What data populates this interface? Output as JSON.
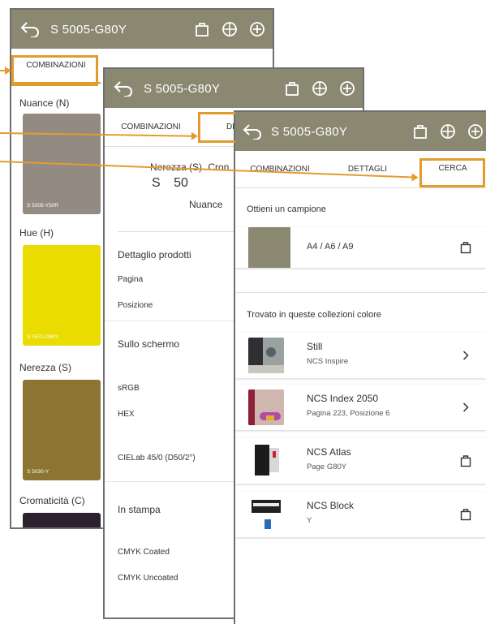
{
  "app": {
    "title": "S 5005-G80Y",
    "color_bar": "#8a8870",
    "accent": "#e39a2d"
  },
  "tabs": {
    "combinazioni": "COMBINAZIONI",
    "dettagli": "DETTAGLI",
    "cerca": "CERCA",
    "dettagli_cut": "DET"
  },
  "screen1": {
    "sections": [
      {
        "label": "Nuance (N)",
        "code": "S 5005-Y50R",
        "color": "#938a82"
      },
      {
        "label": "Hue (H)",
        "code": "S 0570-G80Y",
        "color": "#ebdc00"
      },
      {
        "label": "Nerezza (S)",
        "code": "S 5030-Y",
        "color": "#8c7433"
      },
      {
        "label": "Cromaticità (C)",
        "code": "",
        "color": "#2b2230"
      }
    ]
  },
  "screen2": {
    "nerezza_label": "Nerezza (S)",
    "cromaticita_cut": "Cron",
    "nerezza_value": "S",
    "nerezza_number": "50",
    "nuance_cut": "Nuance",
    "dettaglio_prodotti": "Dettaglio prodotti",
    "pagina": "Pagina",
    "posizione": "Posizione",
    "sullo_schermo": "Sullo schermo",
    "srgb": "sRGB",
    "hex": "HEX",
    "cielab": "CIELab 45/0 (D50/2°)",
    "in_stampa": "In stampa",
    "cmyk_coated": "CMYK Coated",
    "cmyk_uncoated": "CMYK Uncoated"
  },
  "screen3": {
    "sample_title": "Ottieni un campione",
    "sample_sizes": "A4 / A6 / A9",
    "sample_color": "#8a8870",
    "collections_title": "Trovato in queste collezioni colore",
    "collections": [
      {
        "name": "Still",
        "sub": "NCS Inspire",
        "trail": "chevron-right-icon"
      },
      {
        "name": "NCS Index 2050",
        "sub": "Pagina 223, Posizione 6",
        "trail": "chevron-right-icon"
      },
      {
        "name": "NCS Atlas",
        "sub": "Page G80Y",
        "trail": "shopping-bag-icon"
      },
      {
        "name": "NCS Block",
        "sub": "Y",
        "trail": "shopping-bag-icon"
      }
    ]
  }
}
